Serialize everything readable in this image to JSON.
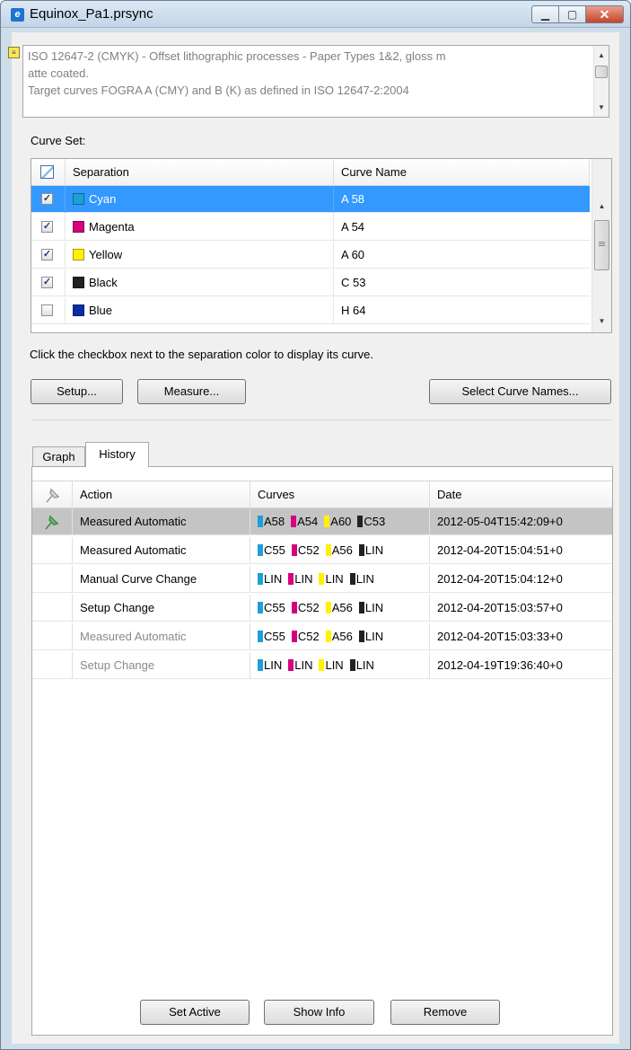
{
  "window": {
    "title": "Equinox_Pa1.prsync",
    "min_glyph": "▁",
    "max_glyph": "▢",
    "close_glyph": "✕"
  },
  "description": {
    "line1": "ISO 12647-2 (CMYK) - Offset lithographic processes - Paper Types 1&2, gloss m",
    "line2": "atte coated.",
    "line3": "Target curves FOGRA A (CMY) and B (K) as defined in ISO 12647-2:2004"
  },
  "curve_set": {
    "label": "Curve Set:",
    "columns": {
      "separation": "Separation",
      "curve_name": "Curve Name"
    },
    "rows": [
      {
        "checked": true,
        "separation": "Cyan",
        "color": "#1ba0d9",
        "curve": "A 58",
        "selected": true
      },
      {
        "checked": true,
        "separation": "Magenta",
        "color": "#d5017f",
        "curve": "A 54",
        "selected": false
      },
      {
        "checked": true,
        "separation": "Yellow",
        "color": "#fff200",
        "curve": "A 60",
        "selected": false
      },
      {
        "checked": true,
        "separation": "Black",
        "color": "#222222",
        "curve": "C 53",
        "selected": false
      },
      {
        "checked": false,
        "separation": "Blue",
        "color": "#0a2fa5",
        "curve": "H 64",
        "selected": false
      }
    ]
  },
  "instruction": "Click the checkbox next to the separation color to display its curve.",
  "buttons": {
    "setup": "Setup...",
    "measure": "Measure...",
    "select_curve_names": "Select Curve Names..."
  },
  "tabs": {
    "graph": "Graph",
    "history": "History"
  },
  "history": {
    "columns": {
      "action": "Action",
      "curves": "Curves",
      "date": "Date"
    },
    "rows": [
      {
        "action": "Measured Automatic",
        "curves": [
          "A58",
          "A54",
          "A60",
          "C53"
        ],
        "date": "2012-05-04T15:42:09+0",
        "active": true,
        "dimmed": false
      },
      {
        "action": "Measured Automatic",
        "curves": [
          "C55",
          "C52",
          "A56",
          "LIN"
        ],
        "date": "2012-04-20T15:04:51+0",
        "active": false,
        "dimmed": false
      },
      {
        "action": "Manual Curve Change",
        "curves": [
          "LIN",
          "LIN",
          "LIN",
          "LIN"
        ],
        "date": "2012-04-20T15:04:12+0",
        "active": false,
        "dimmed": false
      },
      {
        "action": "Setup Change",
        "curves": [
          "C55",
          "C52",
          "A56",
          "LIN"
        ],
        "date": "2012-04-20T15:03:57+0",
        "active": false,
        "dimmed": false
      },
      {
        "action": "Measured Automatic",
        "curves": [
          "C55",
          "C52",
          "A56",
          "LIN"
        ],
        "date": "2012-04-20T15:03:33+0",
        "active": false,
        "dimmed": true
      },
      {
        "action": "Setup Change",
        "curves": [
          "LIN",
          "LIN",
          "LIN",
          "LIN"
        ],
        "date": "2012-04-19T19:36:40+0",
        "active": false,
        "dimmed": true
      }
    ],
    "curve_colors": [
      "#1ba0d9",
      "#d5017f",
      "#fff200",
      "#222222"
    ]
  },
  "history_buttons": {
    "set_active": "Set Active",
    "show_info": "Show Info",
    "remove": "Remove"
  },
  "colors": {
    "selection": "#3399ff",
    "active_row": "#c4c4c4",
    "dimmed_text": "#8a8a8a"
  }
}
